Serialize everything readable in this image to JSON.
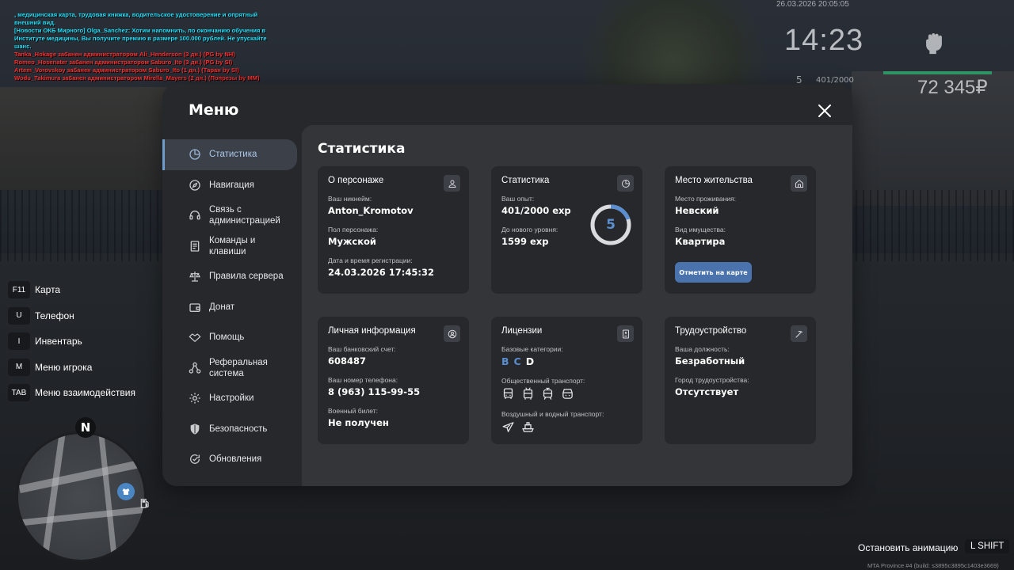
{
  "chat": [
    {
      "text": ", медицинская карта, трудовая книжка, водительское удостоверение и опрятный внешний вид.",
      "color": "#19e3ff"
    },
    {
      "text": "[Новости ОКБ Мирного] Olga_Sanchez: Хотим напомнить, по окончанию обучения в Институте медицины, Вы получите премию в размере 100.000 рублей. Не упускайте шанс.",
      "color": "#19e3ff"
    },
    {
      "text": "Tanka_Hokage забанен администратором Ali_Henderson (3 дн.) (PG by NH)",
      "color": "#ff2a2a"
    },
    {
      "text": "Romeo_Hosenater забанен администратором Saburo_Ito (3 дн.) (PG by SI)",
      "color": "#ff2a2a"
    },
    {
      "text": "Artem_Vorovskoy забанен администратором Saburo_Ito (1 дн.) (Таран by SI)",
      "color": "#ff2a2a"
    },
    {
      "text": "Wodu_Takimura забанен администратором Mirella_Mayers (2 дн.) (Попрезы by MM)",
      "color": "#ff2a2a"
    }
  ],
  "hud": {
    "date": "26.03.2026 20:05:05",
    "time": "14:23",
    "level": "5",
    "exp": "401/2000",
    "money": "72 345₽"
  },
  "keybinds": [
    {
      "key": "F11",
      "label": "Карта"
    },
    {
      "key": "U",
      "label": "Телефон"
    },
    {
      "key": "I",
      "label": "Инвентарь"
    },
    {
      "key": "M",
      "label": "Меню игрока"
    },
    {
      "key": "TAB",
      "label": "Меню взаимодействия"
    }
  ],
  "minimap": {
    "north": "N"
  },
  "bottom": {
    "stop_animation": "Остановить анимацию",
    "stop_key": "L SHIFT",
    "build": "MTA Province #4 (build: s3895c3895c1403e3669)"
  },
  "menu": {
    "title": "Меню",
    "sidebar": [
      {
        "label": "Статистика",
        "icon": "pie-chart-icon"
      },
      {
        "label": "Навигация",
        "icon": "compass-icon"
      },
      {
        "label": "Связь с администрацией",
        "icon": "headset-icon"
      },
      {
        "label": "Команды и клавиши",
        "icon": "document-icon"
      },
      {
        "label": "Правила сервера",
        "icon": "scales-icon"
      },
      {
        "label": "Донат",
        "icon": "wallet-icon"
      },
      {
        "label": "Помощь",
        "icon": "handshake-icon"
      },
      {
        "label": "Реферальная система",
        "icon": "network-icon"
      },
      {
        "label": "Настройки",
        "icon": "gear-icon"
      },
      {
        "label": "Безопасность",
        "icon": "shield-icon"
      },
      {
        "label": "Обновления",
        "icon": "refresh-check-icon"
      }
    ],
    "content_title": "Статистика",
    "cards": {
      "character": {
        "title": "О персонаже",
        "nickname_label": "Ваш никнейм:",
        "nickname": "Anton_Kromotov",
        "gender_label": "Пол персонажа:",
        "gender": "Мужской",
        "reg_label": "Дата и время регистрации:",
        "reg": "24.03.2026 17:45:32"
      },
      "stats": {
        "title": "Статистика",
        "exp_label": "Ваш опыт:",
        "exp": "401/2000 exp",
        "next_label": "До нового уровня:",
        "next": "1599 exp",
        "level": "5",
        "progress": 0.2
      },
      "residence": {
        "title": "Место жительства",
        "place_label": "Место проживания:",
        "place": "Невский",
        "property_label": "Вид имущества:",
        "property": "Квартира",
        "button": "Отметить на карте"
      },
      "personal": {
        "title": "Личная информация",
        "bank_label": "Ваш банковский счет:",
        "bank": "608487",
        "phone_label": "Ваш номер телефона:",
        "phone": "8 (963) 115-99-55",
        "military_label": "Военный билет:",
        "military": "Не получен"
      },
      "licenses": {
        "title": "Лицензии",
        "base_label": "Базовые категории:",
        "categories": [
          {
            "letter": "B",
            "owned": true
          },
          {
            "letter": "C",
            "owned": true
          },
          {
            "letter": "D",
            "owned": false
          }
        ],
        "public_label": "Общественный транспорт:",
        "air_label": "Воздушный и водный транспорт:"
      },
      "job": {
        "title": "Трудоустройство",
        "position_label": "Ваша должность:",
        "position": "Безработный",
        "city_label": "Город трудоустройства:",
        "city": "Отсутствует"
      }
    }
  },
  "colors": {
    "accent": "#5a8ed0",
    "button": "#4a73ad",
    "panel": "#26282b",
    "content": "#333539"
  }
}
